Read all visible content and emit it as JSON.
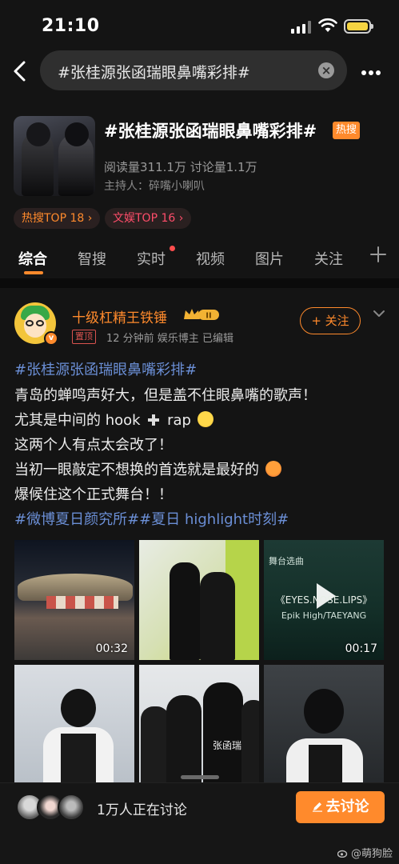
{
  "status_bar": {
    "time": "21:10"
  },
  "search": {
    "query": "#张桂源张函瑞眼鼻嘴彩排#"
  },
  "topic": {
    "title": "#张桂源张函瑞眼鼻嘴彩排#",
    "badge": "热搜",
    "stats": "阅读量311.1万  讨论量1.1万",
    "host": "主持人：碎嘴小喇叭",
    "chips": [
      "热搜TOP 18 ›",
      "文娱TOP 16 ›"
    ]
  },
  "tabs": [
    "综合",
    "智搜",
    "实时",
    "视频",
    "图片",
    "关注"
  ],
  "post": {
    "author": "十级杠精王铁锤",
    "level_badge": "II",
    "pinned_label": "置顶",
    "meta": "12 分钟前  娱乐博主 已编辑",
    "follow_label": "+ 关注",
    "lines": {
      "l1": "#张桂源张函瑞眼鼻嘴彩排#",
      "l2": "青岛的蝉鸣声好大，但是盖不住眼鼻嘴的歌声！",
      "l3a": "尤其是中间的 hook",
      "l3b": "rap",
      "l4": "这两个人有点太会改了！",
      "l5": "当初一眼敲定不想换的首选就是最好的",
      "l6": "爆候住这个正式舞台！！",
      "l7": "#微博夏日颜究所##夏日 highlight时刻#"
    },
    "media": {
      "m1_duration": "00:32",
      "m3_label": "舞台选曲",
      "m3_song": "《EYES.NOSE.LIPS》",
      "m3_artist": "Epik High/TAEYANG",
      "m3_duration": "00:17",
      "m5_name": "张函瑞"
    }
  },
  "bottom": {
    "discussing": "1万人正在讨论",
    "button": "去讨论",
    "watermark": "@萌狗脸"
  },
  "colors": {
    "accent": "#ff8a2c",
    "hashtag": "#6b8fd6",
    "background": "#141414"
  }
}
